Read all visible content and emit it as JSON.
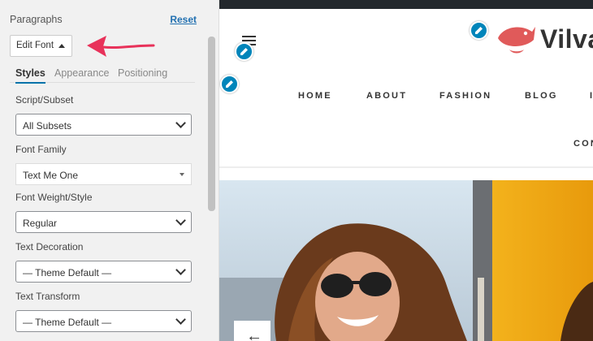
{
  "panel": {
    "title": "Paragraphs",
    "reset_label": "Reset",
    "edit_font_label": "Edit Font",
    "tabs": [
      {
        "label": "Styles",
        "active": true
      },
      {
        "label": "Appearance",
        "active": false
      },
      {
        "label": "Positioning",
        "active": false
      }
    ],
    "fields": {
      "script_subset": {
        "label": "Script/Subset",
        "value": "All Subsets"
      },
      "font_family": {
        "label": "Font Family",
        "value": "Text Me One"
      },
      "font_weight": {
        "label": "Font Weight/Style",
        "value": "Regular"
      },
      "text_decoration": {
        "label": "Text Decoration",
        "value": "— Theme Default —"
      },
      "text_transform": {
        "label": "Text Transform",
        "value": "— Theme Default —"
      }
    }
  },
  "preview": {
    "logo_text": "Vilva",
    "nav": [
      "HOME",
      "ABOUT",
      "FASHION",
      "BLOG",
      "CON"
    ],
    "prev_icon": "←"
  },
  "colors": {
    "accent": "#0085ba",
    "arrow": "#e8325a",
    "logo_red": "#e05a5a"
  },
  "icons": [
    "pencil-icon",
    "hamburger-icon",
    "caret-up-icon",
    "chevron-down-icon",
    "arrow-left-icon"
  ]
}
